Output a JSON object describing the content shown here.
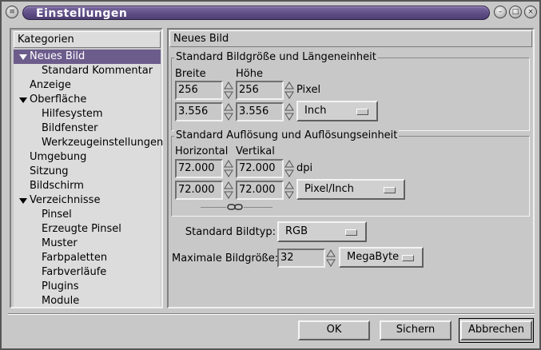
{
  "window": {
    "title": "Einstellungen"
  },
  "sidebar": {
    "header": "Kategorien",
    "items": [
      {
        "label": "Neues Bild",
        "level": 0,
        "expanded": true,
        "selected": true
      },
      {
        "label": "Standard Kommentar",
        "level": 2
      },
      {
        "label": "Anzeige",
        "level": 0
      },
      {
        "label": "Oberfläche",
        "level": 0,
        "expanded": true
      },
      {
        "label": "Hilfesystem",
        "level": 1
      },
      {
        "label": "Bildfenster",
        "level": 1
      },
      {
        "label": "Werkzeugeinstellungen",
        "level": 1
      },
      {
        "label": "Umgebung",
        "level": 0
      },
      {
        "label": "Sitzung",
        "level": 0
      },
      {
        "label": "Bildschirm",
        "level": 0
      },
      {
        "label": "Verzeichnisse",
        "level": 0,
        "expanded": true
      },
      {
        "label": "Pinsel",
        "level": 1
      },
      {
        "label": "Erzeugte Pinsel",
        "level": 1
      },
      {
        "label": "Muster",
        "level": 1
      },
      {
        "label": "Farbpaletten",
        "level": 1
      },
      {
        "label": "Farbverläufe",
        "level": 1
      },
      {
        "label": "Plugins",
        "level": 1
      },
      {
        "label": "Module",
        "level": 1
      }
    ]
  },
  "main": {
    "section_title": "Neues Bild",
    "size_group": {
      "title": "Standard Bildgröße und Längeneinheit",
      "width_label": "Breite",
      "height_label": "Höhe",
      "width_px": "256",
      "height_px": "256",
      "px_unit": "Pixel",
      "width_unit_value": "3.556",
      "height_unit_value": "3.556",
      "unit_option": "Inch"
    },
    "resolution_group": {
      "title": "Standard Auflösung und Auflösungseinheit",
      "horizontal_label": "Horizontal",
      "vertical_label": "Vertikal",
      "horizontal_dpi": "72.000",
      "vertical_dpi": "72.000",
      "dpi_unit": "dpi",
      "horizontal_unit_value": "72.000",
      "vertical_unit_value": "72.000",
      "unit_option": "Pixel/Inch"
    },
    "image_type": {
      "label": "Standard Bildtyp:",
      "option": "RGB"
    },
    "max_size": {
      "label": "Maximale Bildgröße:",
      "value": "32",
      "unit_option": "MegaByte"
    }
  },
  "buttons": {
    "ok": "OK",
    "save": "Sichern",
    "cancel": "Abbrechen"
  },
  "colors": {
    "title_bar": "#5f4e86",
    "selection": "#6c5c8c",
    "window_bg": "#c8c8c8"
  }
}
